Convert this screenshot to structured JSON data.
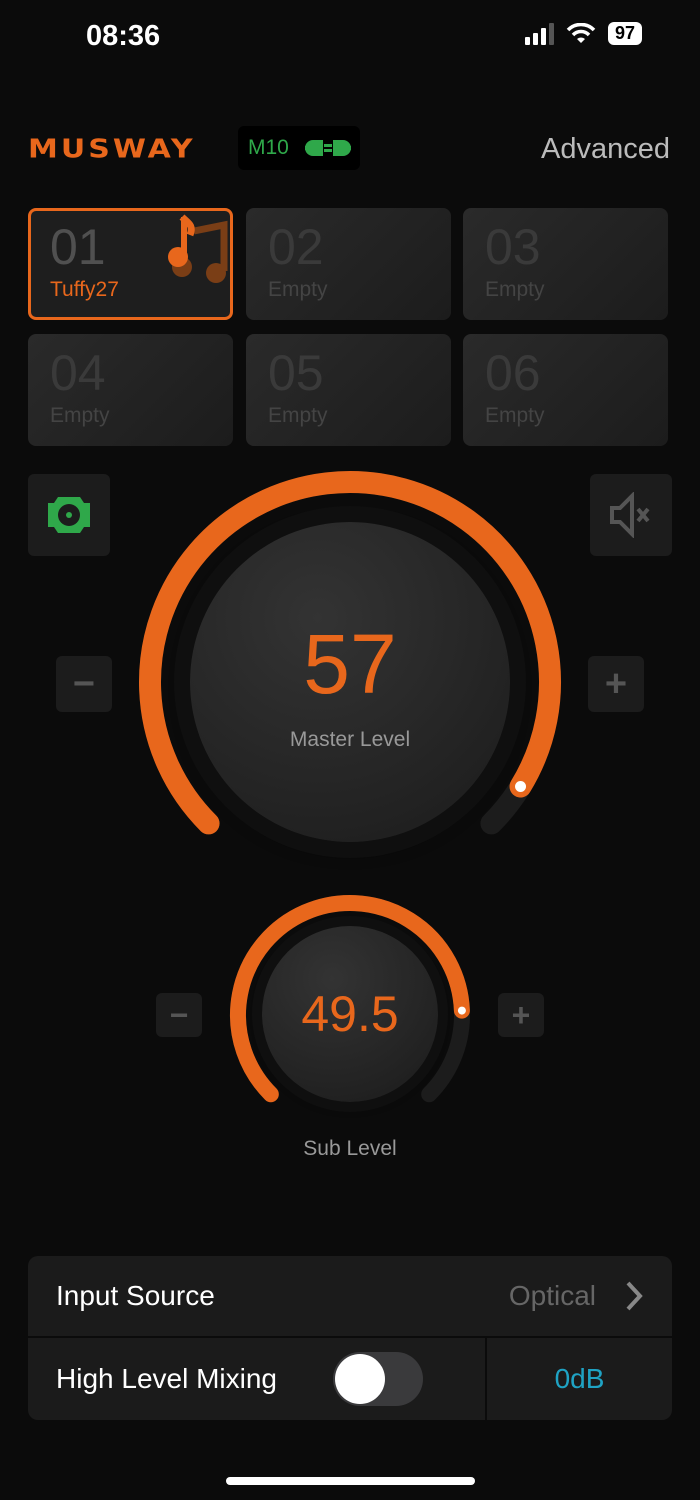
{
  "status_bar": {
    "time": "08:36",
    "battery": "97"
  },
  "header": {
    "brand": "MUSWAY",
    "device": "M10",
    "connection_icon": "plug-connected-icon",
    "advanced_label": "Advanced"
  },
  "presets": [
    {
      "number": "01",
      "name": "Tuffy27",
      "active": true
    },
    {
      "number": "02",
      "name": "Empty"
    },
    {
      "number": "03",
      "name": "Empty"
    },
    {
      "number": "04",
      "name": "Empty"
    },
    {
      "number": "05",
      "name": "Empty"
    },
    {
      "number": "06",
      "name": "Empty"
    }
  ],
  "master": {
    "value": "57",
    "label": "Master Level",
    "fraction": 0.95
  },
  "sub": {
    "value": "49.5",
    "label": "Sub Level",
    "fraction": 0.825
  },
  "colors": {
    "accent": "#e8671c",
    "connected": "#2fa84a",
    "db": "#1fa3c4"
  },
  "settings": {
    "input_source_label": "Input Source",
    "input_source_value": "Optical",
    "mixing_label": "High Level Mixing",
    "mixing_on": false,
    "mixing_gain": "0dB"
  }
}
